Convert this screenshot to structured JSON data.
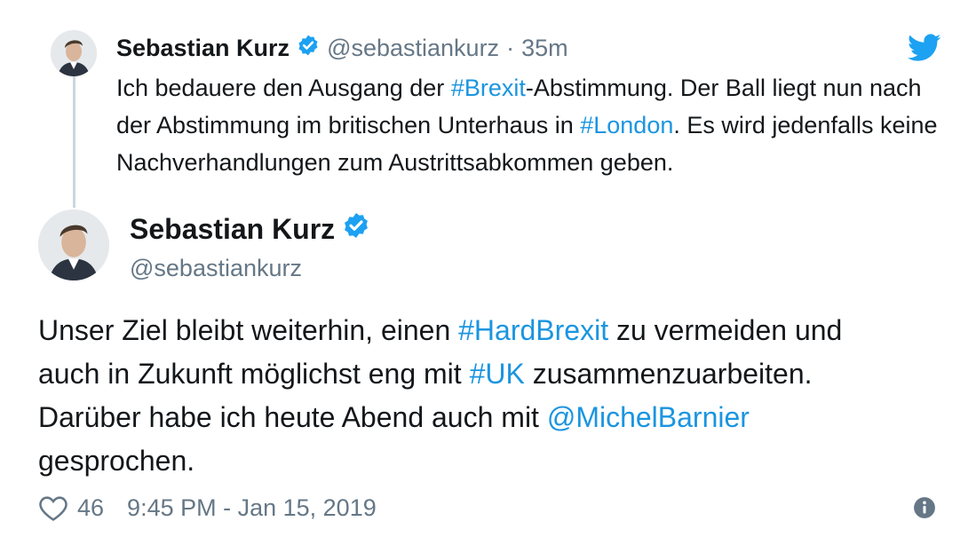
{
  "quoted": {
    "name": "Sebastian Kurz",
    "handle": "@sebastiankurz",
    "separator": "·",
    "time": "35m",
    "text": [
      {
        "t": "Ich bedauere den Ausgang der "
      },
      {
        "t": "#Brexit",
        "link": true
      },
      {
        "t": "-Abstimmung. Der Ball liegt nun nach der Abstimmung im britischen Unterhaus in "
      },
      {
        "t": "#London",
        "link": true
      },
      {
        "t": ". Es wird jedenfalls keine Nachverhandlungen zum Austrittsabkommen geben."
      }
    ]
  },
  "main": {
    "name": "Sebastian Kurz",
    "handle": "@sebastiankurz",
    "text": [
      {
        "t": "Unser Ziel bleibt weiterhin, einen "
      },
      {
        "t": "#HardBrexit",
        "link": true
      },
      {
        "t": " zu vermeiden und auch in Zukunft möglichst eng mit "
      },
      {
        "t": "#UK",
        "link": true
      },
      {
        "t": " zusammenzuarbeiten. Darüber habe ich heute Abend auch mit "
      },
      {
        "t": "@MichelBarnier",
        "link": true
      },
      {
        "t": " gesprochen."
      }
    ],
    "likes": "46",
    "timestamp": "9:45 PM - Jan 15, 2019"
  },
  "icons": {
    "brand": "twitter-bird-icon",
    "verified": "verified-badge-icon",
    "like": "heart-icon",
    "info": "info-icon"
  },
  "colors": {
    "link": "#1b95e0",
    "twitter_blue": "#1da1f2",
    "muted": "#657786",
    "thread_line": "#ccd6dd"
  }
}
